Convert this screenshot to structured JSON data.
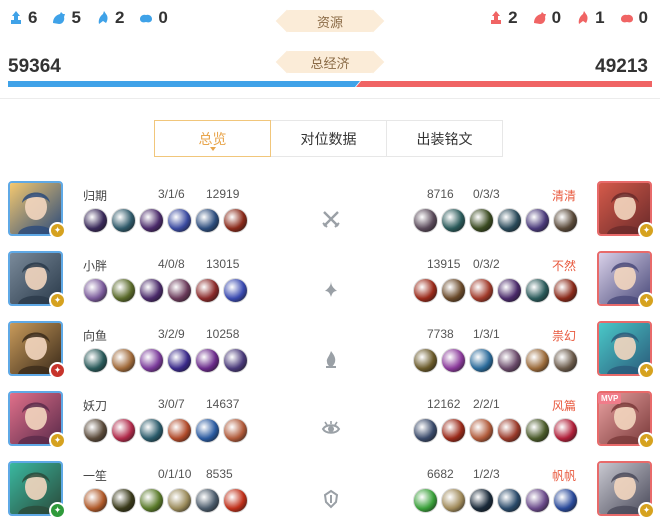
{
  "header": {
    "resources_label": "资源",
    "economy_label": "总经济",
    "left_resources": [
      {
        "icon": "blue-tower-icon",
        "value": "6"
      },
      {
        "icon": "blue-tyrant-icon",
        "value": "5"
      },
      {
        "icon": "blue-overlord-icon",
        "value": "2"
      },
      {
        "icon": "blue-crystal-icon",
        "value": "0"
      }
    ],
    "right_resources": [
      {
        "icon": "red-tower-icon",
        "value": "2"
      },
      {
        "icon": "red-tyrant-icon",
        "value": "0"
      },
      {
        "icon": "red-overlord-icon",
        "value": "1"
      },
      {
        "icon": "red-crystal-icon",
        "value": "0"
      }
    ],
    "left_gold": "59364",
    "right_gold": "49213",
    "blue_share": 0.547
  },
  "tabs": [
    {
      "label": "总览",
      "active": true
    },
    {
      "label": "对位数据",
      "active": false
    },
    {
      "label": "出装铭文",
      "active": false
    }
  ],
  "colors": {
    "blue": "#3fa2e8",
    "red": "#f06464",
    "accent": "#e8a54c",
    "enemy_name": "#e8593e"
  },
  "players": [
    {
      "lane_icon": "solo-lane-swords-icon",
      "left": {
        "name": "归期",
        "kda": "3/1/6",
        "gold": "12919",
        "badge": "gold",
        "avatar_colors": [
          "#f4c870",
          "#2a4a7a"
        ],
        "items": [
          "#3a2a5a",
          "#2f5a6a",
          "#4a2a6a",
          "#3a4aa0",
          "#2d4d7d",
          "#8a2a1a"
        ]
      },
      "right": {
        "name": "清清",
        "kda": "0/3/3",
        "gold": "8716",
        "badge": "gold",
        "avatar_colors": [
          "#d45a4a",
          "#6a2a2a"
        ],
        "items": [
          "#5a4a5a",
          "#2a5a5a",
          "#3a4a20",
          "#2a4a5a",
          "#4a3a7a",
          "#5a4a3a"
        ]
      }
    },
    {
      "lane_icon": "jungle-leaf-icon",
      "left": {
        "name": "小胖",
        "kda": "4/0/8",
        "gold": "13015",
        "badge": "gold",
        "avatar_colors": [
          "#7a8a9a",
          "#2a3a4a"
        ],
        "items": [
          "#7a5a9a",
          "#5a6a2a",
          "#4a2a6a",
          "#6a3a5a",
          "#8a2a2a",
          "#3a4ab0"
        ]
      },
      "right": {
        "name": "不然",
        "kda": "0/3/2",
        "gold": "13915",
        "badge": "gold",
        "avatar_colors": [
          "#d8d0e8",
          "#4a4a7a"
        ],
        "items": [
          "#9a2a1a",
          "#6a4a2a",
          "#a03a2a",
          "#4a2a6a",
          "#2a5a5a",
          "#8a2a1a"
        ]
      }
    },
    {
      "lane_icon": "mid-lane-flame-icon",
      "left": {
        "name": "向鱼",
        "kda": "3/2/9",
        "gold": "10258",
        "badge": "red",
        "avatar_colors": [
          "#c89a5a",
          "#3a2a1a"
        ],
        "items": [
          "#2a5a5a",
          "#a06a3a",
          "#7a3a9a",
          "#3a2a8a",
          "#6a2a8a",
          "#4a3a7a"
        ]
      },
      "right": {
        "name": "祟幻",
        "kda": "1/3/1",
        "gold": "7738",
        "badge": "gold",
        "avatar_colors": [
          "#4ac8c8",
          "#2a5a7a"
        ],
        "items": [
          "#6a5a2a",
          "#8a3a9a",
          "#2a6a9a",
          "#6a4a6a",
          "#9a6a3a",
          "#6a5a4a"
        ]
      }
    },
    {
      "lane_icon": "marksman-eye-icon",
      "left": {
        "name": "妖刀",
        "kda": "3/0/7",
        "gold": "14637",
        "badge": "gold",
        "avatar_colors": [
          "#e0708a",
          "#5a2a4a"
        ],
        "items": [
          "#5a4a3a",
          "#b02a4a",
          "#2a5a6a",
          "#b04a2a",
          "#2a5aa0",
          "#b05a3a"
        ]
      },
      "right": {
        "name": "风篇",
        "kda": "2/2/1",
        "gold": "12162",
        "badge": "gold",
        "mvp": "MVP",
        "avatar_colors": [
          "#e8a0a0",
          "#7a3a3a"
        ],
        "items": [
          "#3a4a6a",
          "#9a2a1a",
          "#b05a3a",
          "#9a3a2a",
          "#4a5a2a",
          "#b0203a"
        ]
      }
    },
    {
      "lane_icon": "support-shield-icon",
      "left": {
        "name": "一笙",
        "kda": "0/1/10",
        "gold": "8535",
        "badge": "green",
        "avatar_colors": [
          "#3ab8a0",
          "#2a4a3a"
        ],
        "items": [
          "#b05a2a",
          "#3a3a1a",
          "#5a7a2a",
          "#9a8a5a",
          "#4a5a6a",
          "#c0301a"
        ]
      },
      "right": {
        "name": "帆帆",
        "kda": "1/2/3",
        "gold": "6682",
        "badge": "gold",
        "avatar_colors": [
          "#c8c8d0",
          "#4a4a5a"
        ],
        "items": [
          "#3aa03a",
          "#a08a5a",
          "#1a2a3a",
          "#2a4a6a",
          "#6a4a8a",
          "#2a4a9a"
        ]
      }
    }
  ]
}
